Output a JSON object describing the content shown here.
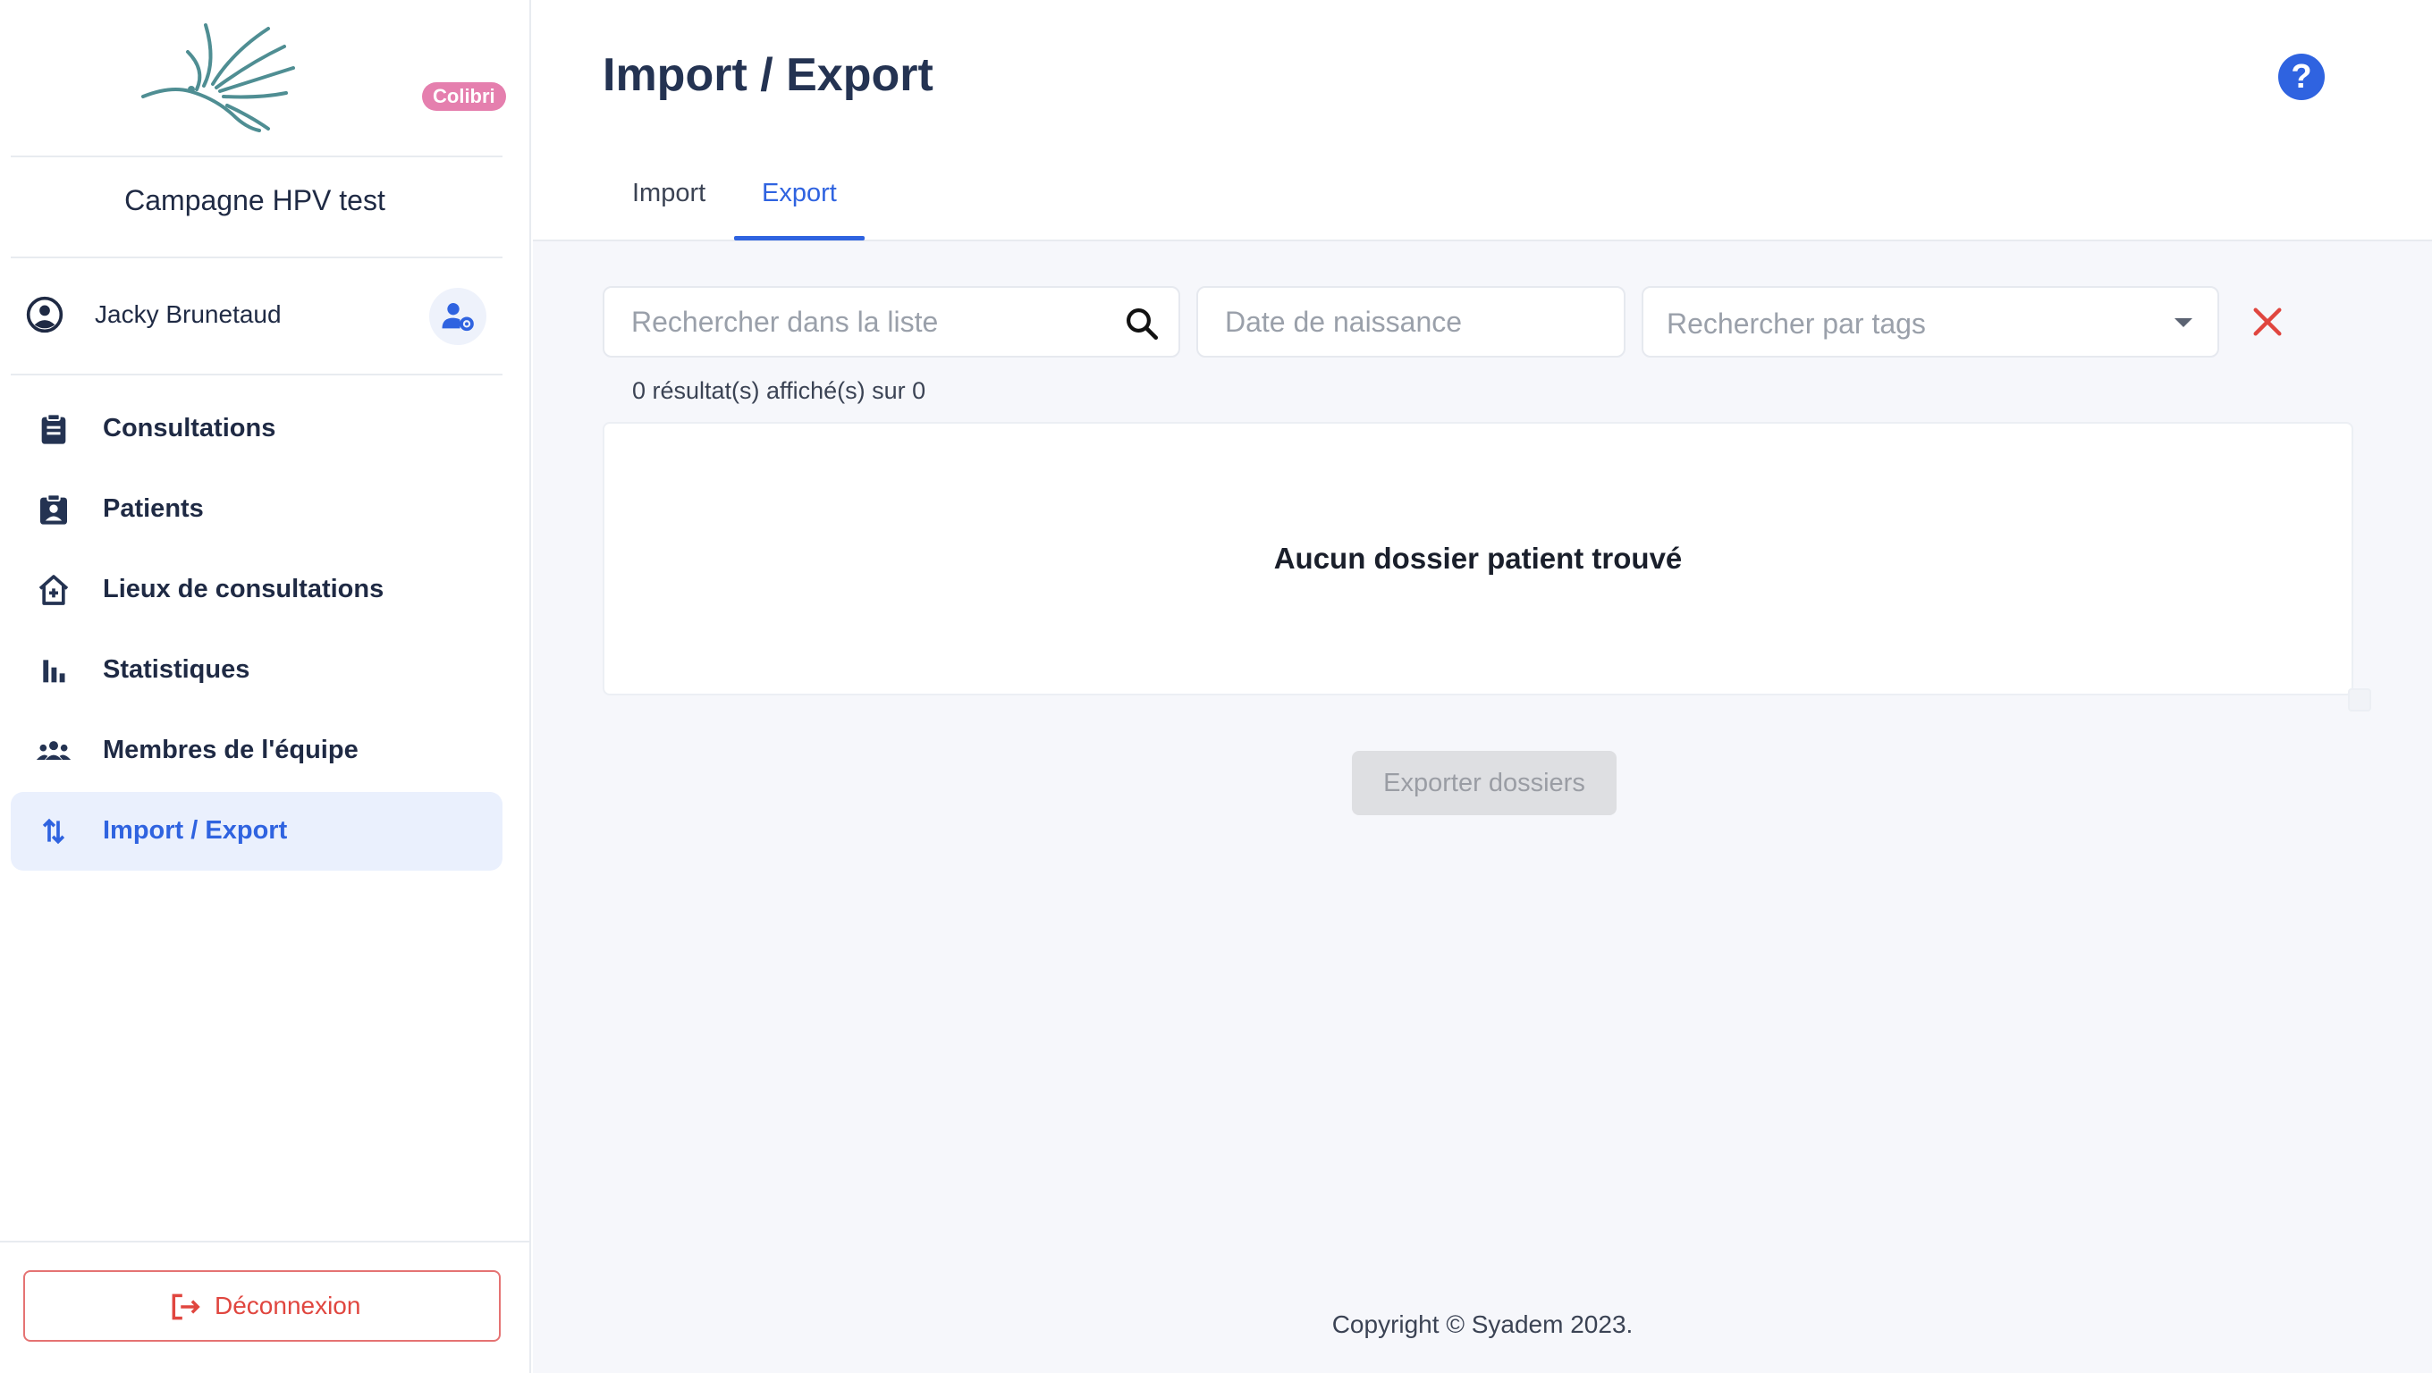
{
  "app": {
    "logo_badge": "Colibri",
    "campaign_name": "Campagne HPV test",
    "colors": {
      "primary": "#2f63e0",
      "danger": "#e0463f",
      "brand_pink": "#e57fae",
      "logo_teal": "#4f8e93"
    }
  },
  "user": {
    "name": "Jacky Brunetaud"
  },
  "sidebar": {
    "items": [
      {
        "label": "Consultations",
        "icon": "clipboard-icon"
      },
      {
        "label": "Patients",
        "icon": "patient-badge-icon"
      },
      {
        "label": "Lieux de consultations",
        "icon": "house-plus-icon"
      },
      {
        "label": "Statistiques",
        "icon": "bar-chart-icon"
      },
      {
        "label": "Membres de l'équipe",
        "icon": "group-icon"
      },
      {
        "label": "Import / Export",
        "icon": "import-export-icon",
        "active": true
      }
    ],
    "logout_label": "Déconnexion"
  },
  "header": {
    "title": "Import / Export",
    "tabs": [
      {
        "label": "Import"
      },
      {
        "label": "Export",
        "active": true
      }
    ]
  },
  "filters": {
    "search_placeholder": "Rechercher dans la liste",
    "birthdate_placeholder": "Date de naissance",
    "tags_placeholder": "Rechercher par tags"
  },
  "results": {
    "count_text": "0 résultat(s) affiché(s) sur 0",
    "empty_message": "Aucun dossier patient trouvé"
  },
  "actions": {
    "export_label": "Exporter dossiers"
  },
  "footer": {
    "copyright": "Copyright © Syadem 2023."
  }
}
